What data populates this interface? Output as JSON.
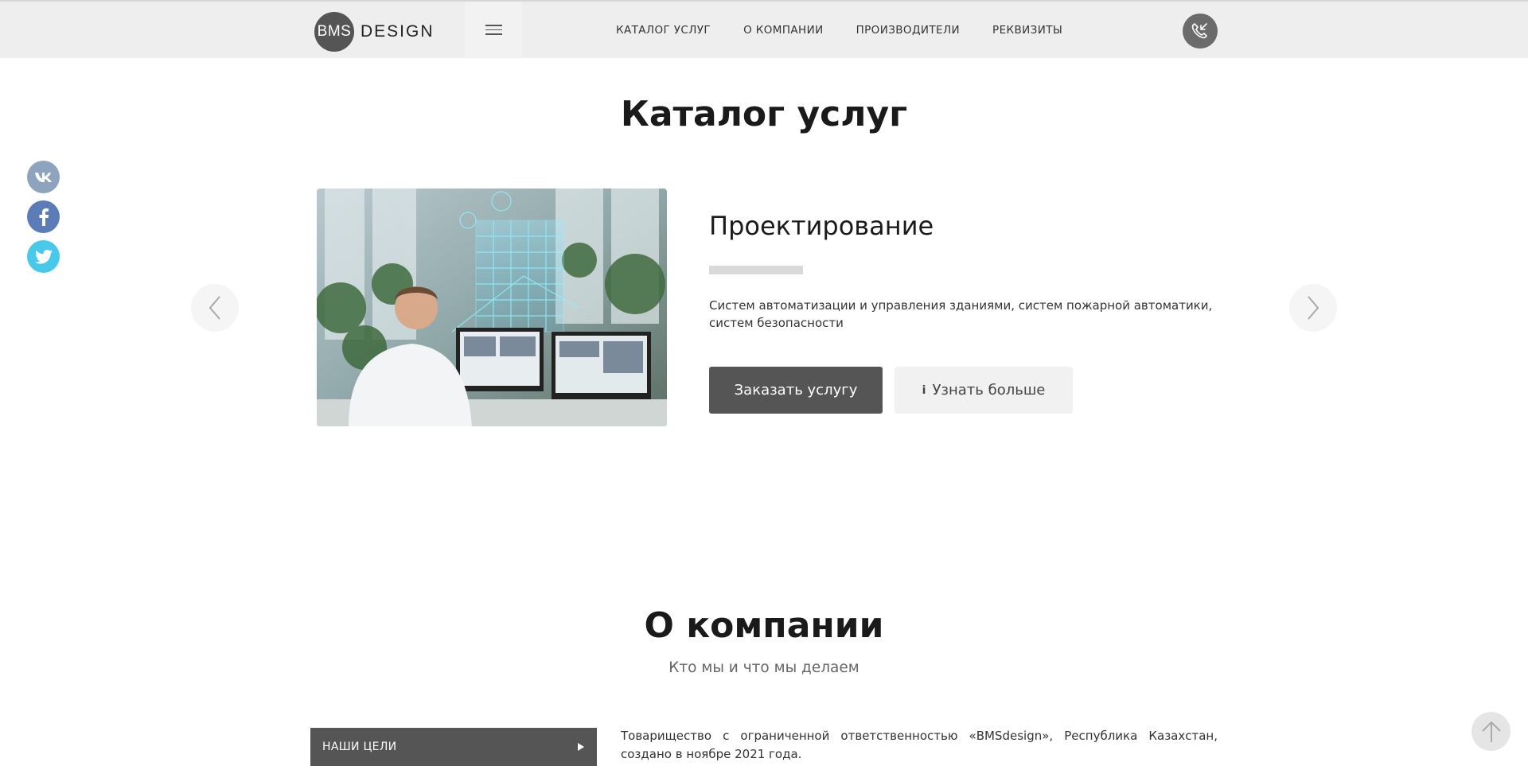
{
  "header": {
    "logo_mark": "BMS",
    "logo_text": "DESIGN",
    "nav": [
      "КАТАЛОГ УСЛУГ",
      "О КОМПАНИИ",
      "ПРОИЗВОДИТЕЛИ",
      "РЕКВИЗИТЫ"
    ]
  },
  "socials": [
    "vk-icon",
    "facebook-icon",
    "twitter-icon"
  ],
  "catalog": {
    "title": "Каталог услуг",
    "slide": {
      "title": "Проектирование",
      "description": "Систем автоматизации и управления зданиями, систем пожарной автоматики, систем безопасности",
      "order_button": "Заказать услугу",
      "more_button": "Узнать больше",
      "info_glyph": "i"
    }
  },
  "about": {
    "title": "О компании",
    "subtitle": "Кто мы и что мы делаем",
    "tab_label": "НАШИ ЦЕЛИ",
    "text": "Товарищество с ограниченной ответственностью «BMSdesign», Республика Казахстан, создано в ноябре 2021 года."
  },
  "colors": {
    "header_bg": "#eeeeee",
    "button_dark": "#555555",
    "vk": "#8da3be",
    "facebook": "#5c7cb8",
    "twitter": "#48c9ea"
  }
}
